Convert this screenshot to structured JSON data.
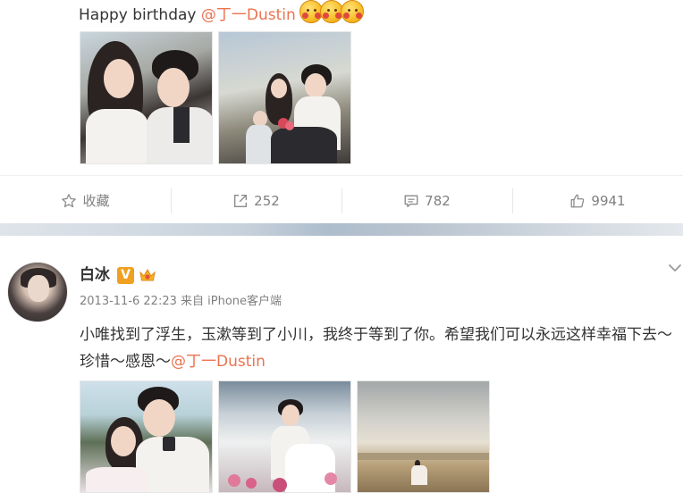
{
  "post1": {
    "text_prefix": "Happy birthday ",
    "mention": "@丁一Dustin",
    "emoji_icons": [
      "kiss-emoji-icon",
      "kiss-emoji-icon",
      "kiss-emoji-icon"
    ],
    "images": [
      "couple-selfie-photo",
      "family-photo"
    ],
    "actions": {
      "favorite_label": "收藏",
      "repost_count": "252",
      "comment_count": "782",
      "like_count": "9941"
    }
  },
  "post2": {
    "author": "白冰",
    "verified_badge": "V",
    "timestamp": "2013-11-6 22:23",
    "source_prefix": "来自 ",
    "source": "iPhone客户端",
    "text": "小唯找到了浮生，玉漱等到了小川，我终于等到了你。希望我们可以永远这样幸福下去～珍惜～感恩～",
    "mention": "@丁一Dustin",
    "images": [
      "wedding-photo-1",
      "wedding-photo-2",
      "wedding-landscape-photo"
    ]
  },
  "colors": {
    "link": "#eb7350",
    "meta": "#808080",
    "text": "#333333",
    "vip": "#f0a020"
  }
}
